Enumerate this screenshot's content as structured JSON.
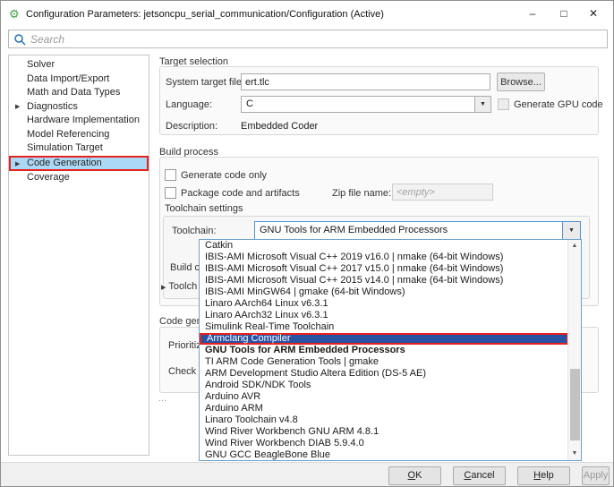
{
  "window": {
    "title": "Configuration Parameters: jetsoncpu_serial_communication/Configuration (Active)",
    "controls": {
      "minimize": "–",
      "maximize": "□",
      "close": "✕"
    }
  },
  "search": {
    "placeholder": "Search"
  },
  "sidebar": {
    "items": [
      {
        "label": "Solver"
      },
      {
        "label": "Data Import/Export"
      },
      {
        "label": "Math and Data Types"
      },
      {
        "label": "Diagnostics",
        "arrow": true
      },
      {
        "label": "Hardware Implementation"
      },
      {
        "label": "Model Referencing"
      },
      {
        "label": "Simulation Target"
      },
      {
        "label": "Code Generation",
        "arrow": true,
        "selected": true
      },
      {
        "label": "Coverage"
      }
    ]
  },
  "target_selection": {
    "title": "Target selection",
    "system_target_file_label": "System target file:",
    "system_target_file_value": "ert.tlc",
    "browse_label": "Browse...",
    "language_label": "Language:",
    "language_value": "C",
    "gpu_checkbox_label": "Generate GPU code",
    "description_label": "Description:",
    "description_value": "Embedded Coder"
  },
  "build_process": {
    "title": "Build process",
    "generate_code_only_label": "Generate code only",
    "package_code_label": "Package code and artifacts",
    "zip_label": "Zip file name:",
    "zip_value": "<empty>",
    "toolchain_settings_label": "Toolchain settings",
    "toolchain_label": "Toolchain:",
    "toolchain_value": "GNU Tools for ARM Embedded Processors",
    "clipped_build_config": "Build c",
    "clipped_toolchain_details": "Toolch"
  },
  "code_generation_section": {
    "clipped_title": "Code gene",
    "clipped_prioritized": "Prioritize",
    "clipped_check": "Check m",
    "ellipsis": "..."
  },
  "toolchain_dropdown": {
    "items": [
      {
        "label": "Catkin"
      },
      {
        "label": "IBIS-AMI Microsoft Visual C++ 2019 v16.0 | nmake (64-bit Windows)"
      },
      {
        "label": "IBIS-AMI Microsoft Visual C++ 2017 v15.0 | nmake (64-bit Windows)"
      },
      {
        "label": "IBIS-AMI Microsoft Visual C++ 2015 v14.0 | nmake (64-bit Windows)"
      },
      {
        "label": "IBIS-AMI MinGW64 | gmake (64-bit Windows)"
      },
      {
        "label": "Linaro AArch64 Linux v6.3.1"
      },
      {
        "label": "Linaro AArch32 Linux v6.3.1"
      },
      {
        "label": "Simulink Real-Time Toolchain"
      },
      {
        "label": "Armclang Compiler",
        "selected": true
      },
      {
        "label": "GNU Tools for ARM Embedded Processors",
        "bold": true
      },
      {
        "label": "TI ARM Code Generation Tools | gmake"
      },
      {
        "label": "ARM Development Studio Altera Edition (DS-5 AE)"
      },
      {
        "label": "Android SDK/NDK Tools"
      },
      {
        "label": "Arduino AVR"
      },
      {
        "label": "Arduino ARM"
      },
      {
        "label": "Linaro Toolchain v4.8"
      },
      {
        "label": "Wind River Workbench GNU ARM 4.8.1"
      },
      {
        "label": "Wind River Workbench DIAB 5.9.4.0"
      },
      {
        "label": "GNU GCC BeagleBone Blue"
      }
    ]
  },
  "footer": {
    "buttons": [
      {
        "pre": "O",
        "rest": "K"
      },
      {
        "pre": "C",
        "rest": "ancel"
      },
      {
        "pre": "H",
        "rest": "elp"
      },
      {
        "pre": "",
        "rest": "Apply",
        "disabled": true,
        "narrow": true
      }
    ]
  },
  "colors": {
    "selection_blue": "#2a52a2",
    "annotation_red": "#e42320",
    "sidebar_selection": "#abd8f4",
    "focus_border_blue": "#4f94d4"
  }
}
